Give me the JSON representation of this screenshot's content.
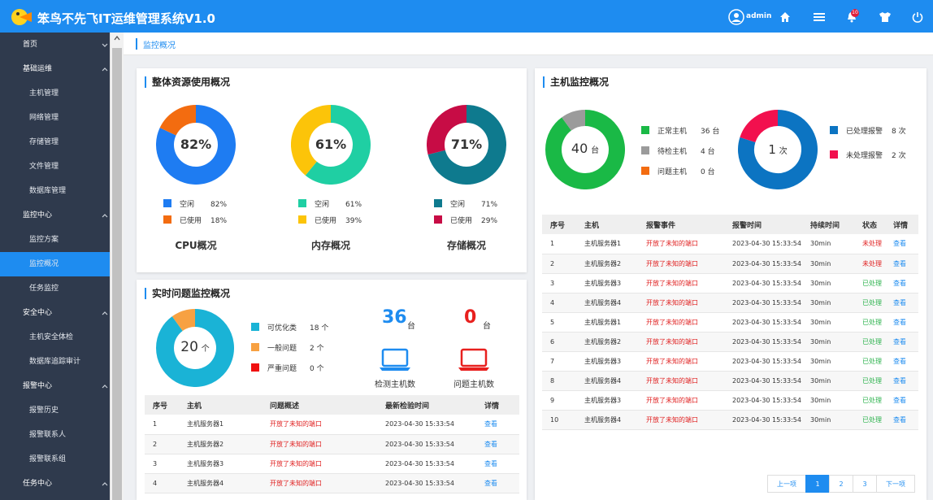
{
  "header": {
    "title": "笨鸟不先飞IT运维管理系统V1.0",
    "user": "admin",
    "notification_count": "10",
    "brand_color": "#1e8cf0"
  },
  "sidebar": {
    "items": [
      {
        "label": "首页",
        "level": 1,
        "chevron": "down"
      },
      {
        "label": "基础运维",
        "level": 1,
        "chevron": "up"
      },
      {
        "label": "主机管理",
        "level": 2
      },
      {
        "label": "网络管理",
        "level": 2
      },
      {
        "label": "存储管理",
        "level": 2
      },
      {
        "label": "文件管理",
        "level": 2
      },
      {
        "label": "数据库管理",
        "level": 2
      },
      {
        "label": "监控中心",
        "level": 1,
        "chevron": "up"
      },
      {
        "label": "监控方案",
        "level": 2
      },
      {
        "label": "监控概况",
        "level": 2,
        "active": true
      },
      {
        "label": "任务监控",
        "level": 2
      },
      {
        "label": "安全中心",
        "level": 1,
        "chevron": "up"
      },
      {
        "label": "主机安全体检",
        "level": 2
      },
      {
        "label": "数据库追踪审计",
        "level": 2
      },
      {
        "label": "报警中心",
        "level": 1,
        "chevron": "up"
      },
      {
        "label": "报警历史",
        "level": 2
      },
      {
        "label": "报警联系人",
        "level": 2
      },
      {
        "label": "报警联系组",
        "level": 2
      },
      {
        "label": "任务中心",
        "level": 1,
        "chevron": "up"
      }
    ]
  },
  "breadcrumb": "监控概况",
  "resource": {
    "title": "整体资源使用概况",
    "charts": [
      {
        "name": "CPU概况",
        "center": "82%",
        "free_label": "空闲",
        "free": 82,
        "free_text": "82%",
        "used_label": "已使用",
        "used": 18,
        "used_text": "18%",
        "free_color": "#1e7cf2",
        "used_color": "#f36c10"
      },
      {
        "name": "内存概况",
        "center": "61%",
        "free_label": "空闲",
        "free": 61,
        "free_text": "61%",
        "used_label": "已使用",
        "used": 39,
        "used_text": "39%",
        "free_color": "#1fcfa3",
        "used_color": "#fcc409"
      },
      {
        "name": "存储概况",
        "center": "71%",
        "free_label": "空闲",
        "free": 71,
        "free_text": "71%",
        "used_label": "已使用",
        "used": 29,
        "used_text": "29%",
        "free_color": "#0e7a8e",
        "used_color": "#c70c45"
      }
    ]
  },
  "realtime": {
    "title": "实时问题监控概况",
    "center_num": "20",
    "center_unit": "个",
    "legend": [
      {
        "label": "可优化类",
        "value": "18 个",
        "count": 18,
        "color": "#1ab3d6"
      },
      {
        "label": "一般问题",
        "value": "2 个",
        "count": 2,
        "color": "#f7a142"
      },
      {
        "label": "严重问题",
        "value": "0 个",
        "count": 0,
        "color": "#f01010"
      }
    ],
    "checked_num": "36",
    "checked_unit": "台",
    "checked_label": "检测主机数",
    "problem_num": "0",
    "problem_unit": "台",
    "problem_label": "问题主机数",
    "table": {
      "headers": [
        "序号",
        "主机",
        "问题概述",
        "最新检验时间",
        "详情"
      ],
      "rows": [
        [
          "1",
          "主机服务器1",
          "开放了未知的端口",
          "2023-04-30 15:33:54",
          "查看"
        ],
        [
          "2",
          "主机服务器2",
          "开放了未知的端口",
          "2023-04-30 15:33:54",
          "查看"
        ],
        [
          "3",
          "主机服务器3",
          "开放了未知的端口",
          "2023-04-30 15:33:54",
          "查看"
        ],
        [
          "4",
          "主机服务器4",
          "开放了未知的端口",
          "2023-04-30 15:33:54",
          "查看"
        ]
      ]
    }
  },
  "host_monitor": {
    "title": "主机监控概况",
    "host_center_num": "40",
    "host_center_unit": "台",
    "host_legend": [
      {
        "label": "正常主机",
        "value": "36 台",
        "count": 36,
        "color": "#1ab946"
      },
      {
        "label": "待检主机",
        "value": "4 台",
        "count": 4,
        "color": "#9b9b9b"
      },
      {
        "label": "问题主机",
        "value": "0 台",
        "count": 0,
        "color": "#f36c10"
      }
    ],
    "alarm_center_num": "1",
    "alarm_center_unit": "次",
    "alarm_legend": [
      {
        "label": "已处理报警",
        "value": "8 次",
        "count": 8,
        "color": "#0c74c2"
      },
      {
        "label": "未处理报警",
        "value": "2 次",
        "count": 2,
        "color": "#f2104e"
      }
    ],
    "table": {
      "headers": [
        "序号",
        "主机",
        "报警事件",
        "报警时间",
        "持续时间",
        "状态",
        "详情"
      ],
      "rows": [
        [
          "1",
          "主机服务器1",
          "开放了未知的端口",
          "2023-04-30 15:33:54",
          "30min",
          "未处理",
          "查看"
        ],
        [
          "2",
          "主机服务器2",
          "开放了未知的端口",
          "2023-04-30 15:33:54",
          "30min",
          "未处理",
          "查看"
        ],
        [
          "3",
          "主机服务器3",
          "开放了未知的端口",
          "2023-04-30 15:33:54",
          "30min",
          "已处理",
          "查看"
        ],
        [
          "4",
          "主机服务器4",
          "开放了未知的端口",
          "2023-04-30 15:33:54",
          "30min",
          "已处理",
          "查看"
        ],
        [
          "5",
          "主机服务器1",
          "开放了未知的端口",
          "2023-04-30 15:33:54",
          "30min",
          "已处理",
          "查看"
        ],
        [
          "6",
          "主机服务器2",
          "开放了未知的端口",
          "2023-04-30 15:33:54",
          "30min",
          "已处理",
          "查看"
        ],
        [
          "7",
          "主机服务器3",
          "开放了未知的端口",
          "2023-04-30 15:33:54",
          "30min",
          "已处理",
          "查看"
        ],
        [
          "8",
          "主机服务器4",
          "开放了未知的端口",
          "2023-04-30 15:33:54",
          "30min",
          "已处理",
          "查看"
        ],
        [
          "9",
          "主机服务器3",
          "开放了未知的端口",
          "2023-04-30 15:33:54",
          "30min",
          "已处理",
          "查看"
        ],
        [
          "10",
          "主机服务器4",
          "开放了未知的端口",
          "2023-04-30 15:33:54",
          "30min",
          "已处理",
          "查看"
        ]
      ]
    }
  },
  "pagination": {
    "prev": "上一项",
    "pages": [
      "1",
      "2",
      "3"
    ],
    "current": "1",
    "next": "下一项"
  }
}
